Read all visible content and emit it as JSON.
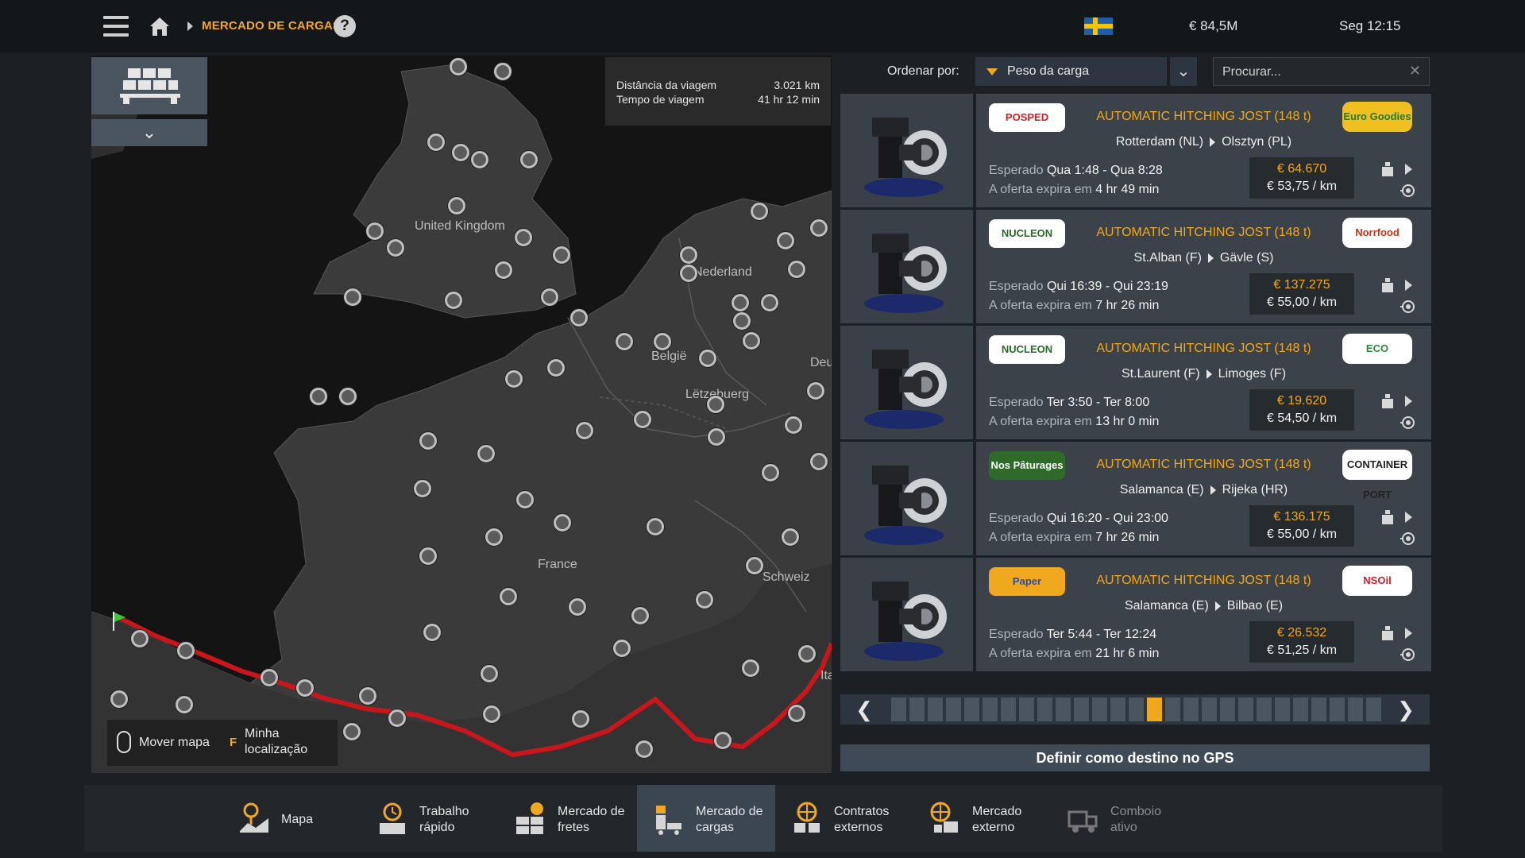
{
  "topbar": {
    "breadcrumb": "MERCADO DE CARGAS",
    "help": "?",
    "money": "€ 84,5M",
    "clock": "Seg 12:15"
  },
  "map": {
    "labels": {
      "uk": "United Kingdom",
      "nl": "Nederland",
      "be": "België",
      "lu": "Lëtzebuerg",
      "de": "Deu",
      "fr": "France",
      "ch": "Schweiz",
      "it": "Ita"
    },
    "trip": {
      "distance_label": "Distância da viagem",
      "distance_value": "3.021 km",
      "time_label": "Tempo de viagem",
      "time_value": "41 hr 12 min"
    },
    "hints": {
      "move_key_icon": "mouse-icon",
      "move_label": "Mover mapa",
      "locate_key": "F",
      "locate_label": "Minha\nlocalização"
    },
    "colors": {
      "route": "#c8161d",
      "land": "#3a3a3a",
      "sea": "#141414"
    }
  },
  "sort": {
    "label": "Ordenar por:",
    "selected": "Peso da carga",
    "search_placeholder": "Procurar..."
  },
  "jobs": [
    {
      "company_from": "POSPED",
      "company_to": "Euro Goodies",
      "cargo": "AUTOMATIC HITCHING JOST (148 t)",
      "origin": "Rotterdam (NL)",
      "destination": "Olsztyn (PL)",
      "expected_label": "Esperado",
      "expected": "Qua 1:48 - Qua 8:28",
      "expires_label": "A oferta expira em",
      "expires": "4 hr 49 min",
      "price": "€ 64.670",
      "per_km": "€ 53,75 / km"
    },
    {
      "company_from": "NUCLEON",
      "company_to": "Norrfood",
      "cargo": "AUTOMATIC HITCHING JOST (148 t)",
      "origin": "St.Alban (F)",
      "destination": "Gävle (S)",
      "expected_label": "Esperado",
      "expected": "Qui 16:39 - Qui 23:19",
      "expires_label": "A oferta expira em",
      "expires": "7 hr 26 min",
      "price": "€ 137.275",
      "per_km": "€ 55,00 / km"
    },
    {
      "company_from": "NUCLEON",
      "company_to": "ECO",
      "cargo": "AUTOMATIC HITCHING JOST (148 t)",
      "origin": "St.Laurent (F)",
      "destination": "Limoges (F)",
      "expected_label": "Esperado",
      "expected": "Ter 3:50 - Ter 8:00",
      "expires_label": "A oferta expira em",
      "expires": "13 hr 0 min",
      "price": "€ 19.620",
      "per_km": "€ 54,50 / km"
    },
    {
      "company_from": "Nos Pâturages",
      "company_to": "CONTAINER PORT",
      "cargo": "AUTOMATIC HITCHING JOST (148 t)",
      "origin": "Salamanca (E)",
      "destination": "Rijeka (HR)",
      "expected_label": "Esperado",
      "expected": "Qui 16:20 - Qui 23:00",
      "expires_label": "A oferta expira em",
      "expires": "7 hr 26 min",
      "price": "€ 136.175",
      "per_km": "€ 55,00 / km"
    },
    {
      "company_from": "Paper",
      "company_to": "NSOil",
      "cargo": "AUTOMATIC HITCHING JOST (148 t)",
      "origin": "Salamanca (E)",
      "destination": "Bilbao (E)",
      "expected_label": "Esperado",
      "expected": "Ter 5:44 - Ter 12:24",
      "expires_label": "A oferta expira em",
      "expires": "21 hr 6 min",
      "price": "€ 26.532",
      "per_km": "€ 51,25 / km"
    }
  ],
  "pager": {
    "pages": 27,
    "current": 15,
    "prev": "‹",
    "next": "›"
  },
  "gps_button": "Definir como destino no GPS",
  "bottom_nav": [
    {
      "label": "Mapa",
      "icon": "map-icon",
      "state": "normal"
    },
    {
      "label": "Trabalho\nrápido",
      "icon": "quick-job-icon",
      "state": "normal"
    },
    {
      "label": "Mercado de\nfretes",
      "icon": "freight-market-icon",
      "state": "normal"
    },
    {
      "label": "Mercado de\ncargas",
      "icon": "cargo-market-icon",
      "state": "active"
    },
    {
      "label": "Contratos\nexternos",
      "icon": "external-contracts-icon",
      "state": "normal"
    },
    {
      "label": "Mercado\nexterno",
      "icon": "external-market-icon",
      "state": "normal"
    },
    {
      "label": "Comboio\nativo",
      "icon": "convoy-icon",
      "state": "disabled"
    }
  ]
}
